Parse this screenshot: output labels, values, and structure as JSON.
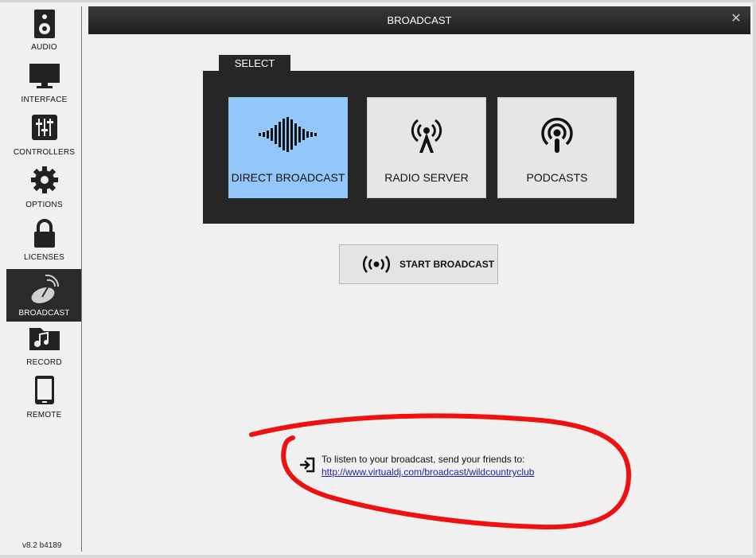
{
  "sidebar": {
    "items": [
      {
        "label": "AUDIO",
        "icon": "speaker-icon"
      },
      {
        "label": "INTERFACE",
        "icon": "monitor-icon"
      },
      {
        "label": "CONTROLLERS",
        "icon": "sliders-icon"
      },
      {
        "label": "OPTIONS",
        "icon": "gear-icon"
      },
      {
        "label": "LICENSES",
        "icon": "lock-icon"
      },
      {
        "label": "BROADCAST",
        "icon": "satellite-dish-icon"
      },
      {
        "label": "RECORD",
        "icon": "music-folder-icon"
      },
      {
        "label": "REMOTE",
        "icon": "phone-icon"
      }
    ],
    "active": "BROADCAST",
    "version": "v8.2 b4189"
  },
  "window": {
    "title": "BROADCAST"
  },
  "select": {
    "tab_label": "SELECT",
    "options": [
      {
        "label": "DIRECT BROADCAST",
        "icon": "waveform-icon",
        "selected": true
      },
      {
        "label": "RADIO SERVER",
        "icon": "radio-tower-icon",
        "selected": false
      },
      {
        "label": "PODCASTS",
        "icon": "podcast-icon",
        "selected": false
      }
    ]
  },
  "start": {
    "label": "START BROADCAST",
    "icon": "broadcast-waves-icon"
  },
  "share": {
    "text": "To listen to your broadcast, send your friends to:",
    "link": "http://www.virtualdj.com/broadcast/wildcountryclub",
    "icon": "sign-in-icon"
  },
  "colors": {
    "accent": "#93c7fa",
    "panel": "#262626",
    "annotation": "#ee1111"
  }
}
